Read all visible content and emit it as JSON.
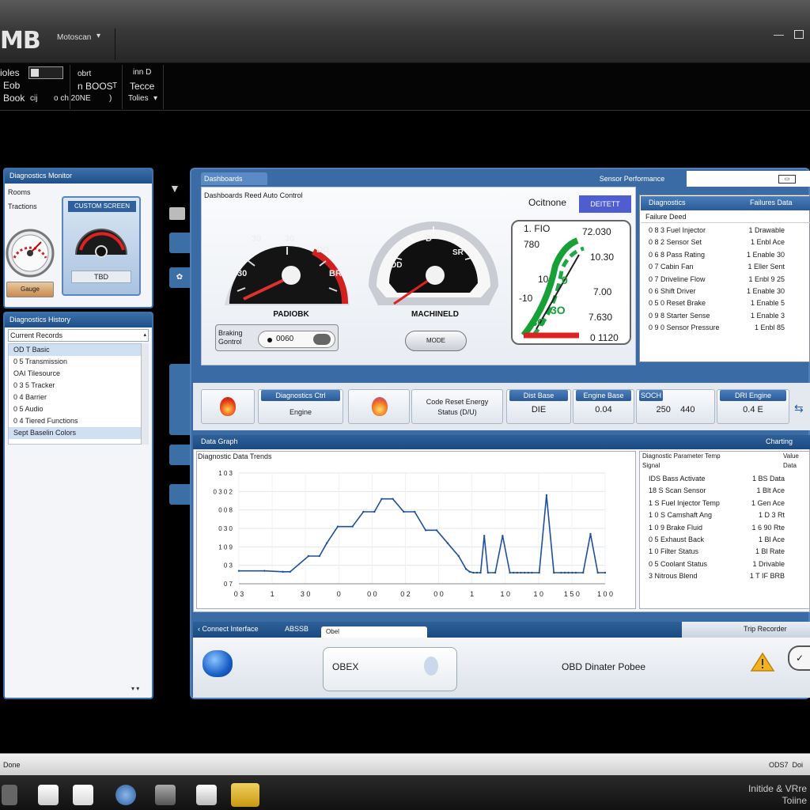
{
  "window": {
    "logo": "MB",
    "app_menu": "Motoscan",
    "min_icon": "minimize-icon",
    "max_icon": "maximize-icon"
  },
  "toolbar": {
    "col1": [
      "ioles",
      "Eob",
      "Book"
    ],
    "col1_suffix": "cij",
    "col2": [
      "obrt",
      "n BOOS",
      "o  ch 20NE"
    ],
    "col2_suffix": [
      "T",
      ")"
    ],
    "col3": [
      "inn D",
      "Tecce",
      "Tolies"
    ]
  },
  "left_gauge_panel": {
    "title": "Diagnostics Monitor",
    "labels": [
      "Rooms",
      "Tractions"
    ],
    "inner_title": "CUSTOM SCREEN",
    "inner_value": "TBD",
    "bottom_btn": "Gauge"
  },
  "left_list_panel": {
    "title": "Diagnostics History",
    "dropdown": "Current Records",
    "items": [
      "OD T Basic",
      "0 5 Transmission",
      "OAI Tilesource",
      "0 3 5 Tracker",
      "0 4 Barrier",
      "0 5 Audio",
      "0 4 Tiered Functions",
      "Sept Baselin Colors"
    ]
  },
  "dash": {
    "tab": "Dashboards",
    "header_right": "Sensor Performance",
    "subtitle": "Dashboards Reed Auto Control",
    "gauge1": {
      "label": "PADIOBK",
      "ticks": [
        "30",
        "DD",
        "30",
        "BR"
      ]
    },
    "gauge2": {
      "label": "MACHINELD",
      "ticks": [
        "D",
        "DD",
        "SR"
      ]
    },
    "switch_label": [
      "Braking",
      "Gontrol"
    ],
    "switch_value": "0060",
    "mode_btn": "MODE",
    "online_label": "Ocitnone",
    "online_btn": "DEITETT",
    "meter": {
      "top_left": "1. FIO",
      "left": [
        "780",
        "10",
        "-10"
      ],
      "mid": [
        "0",
        "3O",
        "3O"
      ],
      "right": [
        "72.030",
        "10.30",
        "7.00",
        "7.630",
        "0 1120"
      ]
    }
  },
  "diag_table": {
    "head_left": "Diagnostics",
    "head_right": "Failures Data",
    "subhead": "Failure Deed",
    "rows": [
      [
        "0 8 3 Fuel Injector",
        "1 Drawable"
      ],
      [
        "0 8 2 Sensor Set",
        "1 Enbl Ace"
      ],
      [
        "0 6 8 Pass Rating",
        "1 Enable 30"
      ],
      [
        "0 7 Cabin Fan",
        "1 Eller Sent"
      ],
      [
        "0 7 Driveline Flow",
        "1 Enbl 9 25"
      ],
      [
        "0 6 Shift Driver",
        "1 Enable 30"
      ],
      [
        "0 5 0 Reset Brake",
        "1 Enable 5"
      ],
      [
        "0 9 8 Starter Sense",
        "1 Enable 3"
      ],
      [
        "0 9 0 Sensor Pressure",
        "1 Enbl 85"
      ]
    ]
  },
  "cards": [
    {
      "icon": "flame-icon",
      "label": "Engine",
      "header": "Diagnostics Ctrl"
    },
    {
      "icon": "flame-icon",
      "lines": [
        "Code Reset Energy",
        "Status (D/U)"
      ]
    },
    {
      "header": "Dist Base",
      "value": "DIE"
    },
    {
      "header": "Engine Base",
      "value": "0.04"
    },
    {
      "header": "SOCH",
      "value": "250    440"
    },
    {
      "header": "DRI Engine",
      "value": "0.4 E"
    }
  ],
  "graph": {
    "title": "Data Graph",
    "header_right": "Charting",
    "subtitle": "Diagnostic Data Trends",
    "right_head": [
      "Diagnostic Parameter Temp",
      "Signal",
      "Value",
      "Data"
    ],
    "rows": [
      [
        "IDS Bass Activate",
        "1 BS Data"
      ],
      [
        "18 S Scan Sensor",
        "1 Blt Ace"
      ],
      [
        "1 S Fuel Injector Temp",
        "1 Gen Ace"
      ],
      [
        "1 0 S Camshaft Ang",
        "1 D 3 Rt"
      ],
      [
        "1 0 9 Brake Fluid",
        "1 6 90 Rte"
      ],
      [
        "0 5 Exhaust Back",
        "1 Bl Ace"
      ],
      [
        "1 0 Filter Status",
        "1 Bl Rate"
      ],
      [
        "0 5 Coolant Status",
        "1 Drivable"
      ],
      [
        "3 Nitrous Blend",
        "1 T IF BRB"
      ]
    ]
  },
  "chart_data": {
    "type": "line",
    "title": "Diagnostic Data Trends",
    "yticks": [
      "1 0 3",
      "0 3 0 2",
      "0 0 8",
      "0 3 0",
      "1 0 9",
      "0 3",
      "0 7"
    ],
    "xticks": [
      "0 3",
      "1",
      "3 0",
      "0",
      "0 0",
      "0 2",
      "0 0",
      "1",
      "1 0",
      "1 0",
      "1 5 0",
      "1 0 0"
    ],
    "ylim": [
      0,
      6
    ],
    "series": [
      {
        "x": [
          0,
          7,
          12,
          14,
          19,
          22,
          24,
          27,
          31,
          34,
          37,
          39,
          42,
          45,
          48,
          51,
          54,
          57,
          60,
          62,
          63,
          64,
          65,
          66,
          67,
          68,
          70,
          72,
          74,
          75,
          76,
          77,
          78,
          79,
          80,
          82,
          84,
          86,
          88,
          89,
          90,
          91,
          92,
          94,
          96,
          98,
          100
        ],
        "y": [
          0.7,
          0.7,
          0.65,
          0.65,
          1.5,
          1.5,
          2.2,
          3.1,
          3.1,
          3.9,
          3.9,
          4.6,
          4.6,
          3.9,
          3.9,
          2.9,
          2.9,
          2.2,
          1.5,
          0.8,
          0.65,
          0.6,
          0.6,
          0.6,
          2.6,
          0.6,
          0.6,
          2.6,
          0.6,
          0.6,
          0.6,
          0.6,
          0.6,
          0.6,
          0.6,
          0.6,
          4.8,
          0.6,
          0.6,
          0.6,
          0.6,
          0.6,
          0.6,
          0.6,
          2.7,
          0.6,
          0.6
        ]
      }
    ]
  },
  "bottom": {
    "tab": "Connect Interface",
    "tab2": "ABSSB",
    "field": "Obel",
    "header_right": "Trip Recorder",
    "obd_btn": "OBEX",
    "obd_text": "OBD Dinater Pobee"
  },
  "statusbar": {
    "left": "Done",
    "right": "ODS7  Doi"
  },
  "taskbar": {
    "clock": [
      "Initide & VRre",
      "Toiine"
    ]
  }
}
